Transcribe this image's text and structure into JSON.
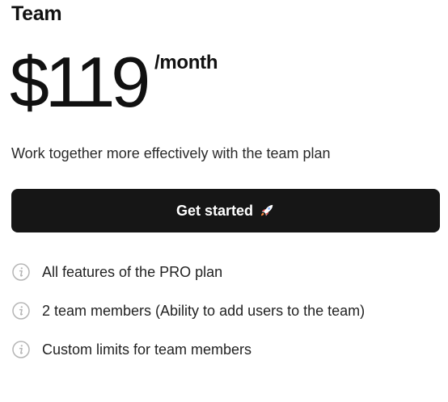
{
  "plan": {
    "name": "Team",
    "price": "$119",
    "period": "/month",
    "description": "Work together more effectively with the team plan"
  },
  "cta": {
    "label": "Get started",
    "icon": "rocket-icon",
    "background": "#161616",
    "text_color": "#ffffff"
  },
  "features": [
    {
      "icon": "info-icon",
      "text": "All features of the PRO plan"
    },
    {
      "icon": "info-icon",
      "text": "2 team members (Ability to add users to the team)"
    },
    {
      "icon": "info-icon",
      "text": "Custom limits for team members"
    }
  ],
  "colors": {
    "text": "#111111",
    "muted_icon": "#b5b5b5"
  }
}
